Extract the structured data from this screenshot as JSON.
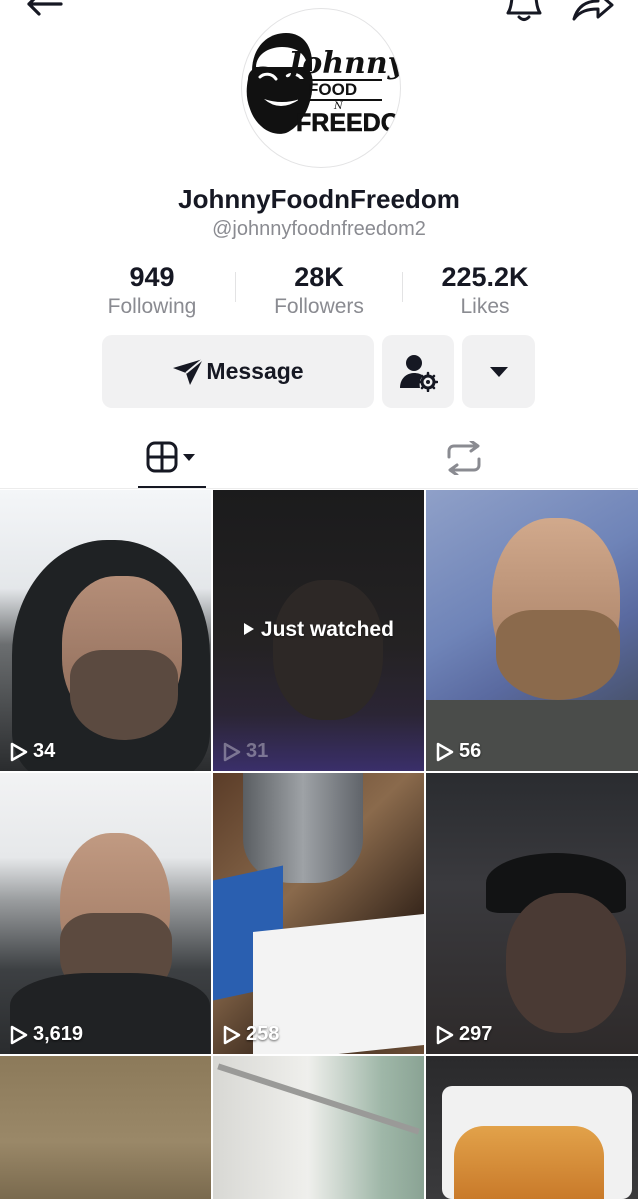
{
  "header": {
    "back_icon": "arrow-left-icon",
    "notification_icon": "bell-icon",
    "share_icon": "share-arrow-icon"
  },
  "profile": {
    "logo_text": {
      "line1": "Johnny",
      "line2": "FOOD",
      "line3": "N",
      "line4": "FREEDO"
    },
    "display_name": "JohnnyFoodnFreedom",
    "username": "@johnnyfoodnfreedom2"
  },
  "stats": [
    {
      "value": "949",
      "label": "Following"
    },
    {
      "value": "28K",
      "label": "Followers"
    },
    {
      "value": "225.2K",
      "label": "Likes"
    }
  ],
  "actions": {
    "message_label": "Message",
    "message_icon": "send-plane-icon",
    "suggest_icon": "user-settings-icon",
    "more_icon": "caret-down-icon"
  },
  "tabs": [
    {
      "name": "videos",
      "icon": "grid-icon",
      "active": true
    },
    {
      "name": "reposts",
      "icon": "repost-icon",
      "active": false
    }
  ],
  "videos": [
    {
      "views": "34",
      "label": ""
    },
    {
      "views": "31",
      "label": "Just watched"
    },
    {
      "views": "56",
      "label": ""
    },
    {
      "views": "3,619",
      "label": ""
    },
    {
      "views": "258",
      "label": ""
    },
    {
      "views": "297",
      "label": ""
    },
    {
      "views": "",
      "label": ""
    },
    {
      "views": "",
      "label": ""
    },
    {
      "views": "",
      "label": ""
    }
  ],
  "colors": {
    "text_primary": "#161823",
    "text_secondary": "#8a8b91",
    "button_bg": "#f1f1f2"
  }
}
